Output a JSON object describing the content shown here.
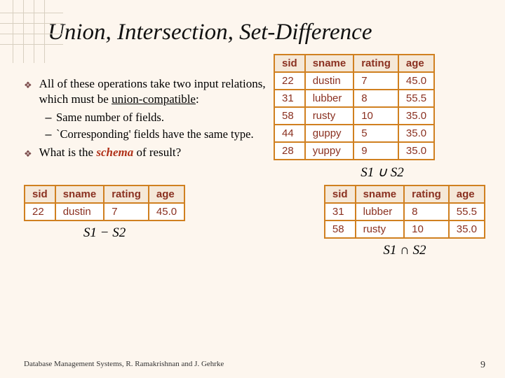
{
  "title": "Union, Intersection, Set-Difference",
  "bullets": {
    "b1_pre": "All of these operations take two input relations, which must be ",
    "b1_key": "union-compatible",
    "b1_post": ":",
    "sub1": "Same number of fields.",
    "sub2": "`Corresponding' fields have the same type.",
    "b2_pre": "What is the ",
    "b2_key": "schema",
    "b2_post": " of result?"
  },
  "headers": {
    "c1": "sid",
    "c2": "sname",
    "c3": "rating",
    "c4": "age"
  },
  "union_table": {
    "r0": {
      "c1": "22",
      "c2": "dustin",
      "c3": "7",
      "c4": "45.0"
    },
    "r1": {
      "c1": "31",
      "c2": "lubber",
      "c3": "8",
      "c4": "55.5"
    },
    "r2": {
      "c1": "58",
      "c2": "rusty",
      "c3": "10",
      "c4": "35.0"
    },
    "r3": {
      "c1": "44",
      "c2": "guppy",
      "c3": "5",
      "c4": "35.0"
    },
    "r4": {
      "c1": "28",
      "c2": "yuppy",
      "c3": "9",
      "c4": "35.0"
    }
  },
  "captions": {
    "union": "S1 ∪ S2",
    "diff": "S1 − S2",
    "inter": "S1 ∩ S2"
  },
  "diff_table": {
    "r0": {
      "c1": "22",
      "c2": "dustin",
      "c3": "7",
      "c4": "45.0"
    }
  },
  "inter_table": {
    "r0": {
      "c1": "31",
      "c2": "lubber",
      "c3": "8",
      "c4": "55.5"
    },
    "r1": {
      "c1": "58",
      "c2": "rusty",
      "c3": "10",
      "c4": "35.0"
    }
  },
  "footer": {
    "text": "Database Management Systems, R. Ramakrishnan and J. Gehrke",
    "page": "9"
  }
}
